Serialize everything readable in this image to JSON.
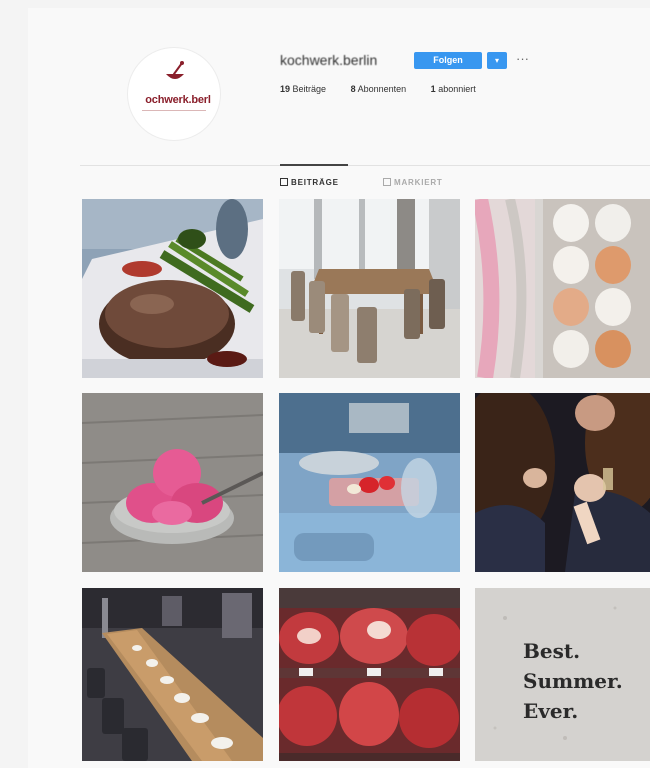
{
  "profile": {
    "username": "kochwerk.berlin",
    "avatar_text": "ochwerk.berl",
    "follow_label": "Folgen",
    "dropdown_icon": "chevron-down-icon",
    "more_label": "···",
    "stats": {
      "posts_count": "19",
      "posts_label": "Beiträge",
      "followers_count": "8",
      "followers_label": "Abonnenten",
      "following_count": "1",
      "following_label": "abonniert"
    }
  },
  "tabs": [
    {
      "label": "BEITRÄGE",
      "active": true
    },
    {
      "label": "MARKIERT",
      "active": false
    }
  ],
  "grid": {
    "posts": [
      {
        "subject": "steak-with-asparagus"
      },
      {
        "subject": "dining-table-and-chairs"
      },
      {
        "subject": "eggs-in-carton"
      },
      {
        "subject": "pink-ice-cream-bowl"
      },
      {
        "subject": "kitchen-chopping"
      },
      {
        "subject": "people-toasting"
      },
      {
        "subject": "long-banquet-table"
      },
      {
        "subject": "meat-in-display-case"
      },
      {
        "subject": "text-quote",
        "text": "Best.\nSummer.\nEver."
      }
    ]
  },
  "colors": {
    "accent": "#3897f0",
    "brand": "#8a1f2b"
  }
}
